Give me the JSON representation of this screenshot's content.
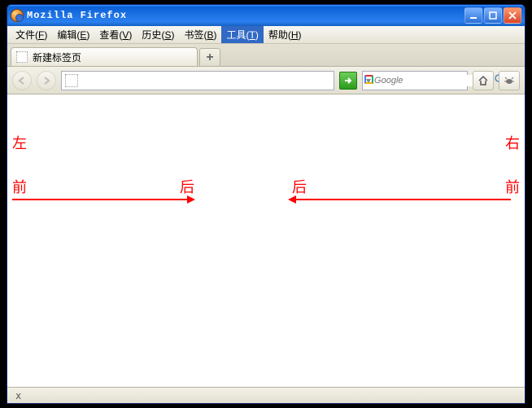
{
  "title": "Mozilla Firefox",
  "menu": {
    "items": [
      {
        "label": "文件",
        "accel": "F"
      },
      {
        "label": "编辑",
        "accel": "E"
      },
      {
        "label": "查看",
        "accel": "V"
      },
      {
        "label": "历史",
        "accel": "S"
      },
      {
        "label": "书签",
        "accel": "B"
      },
      {
        "label": "工具",
        "accel": "T"
      },
      {
        "label": "帮助",
        "accel": "H"
      }
    ],
    "active_index": 5
  },
  "tabs": {
    "items": [
      {
        "label": "新建标签页"
      }
    ],
    "newtab_symbol": "+"
  },
  "toolbar": {
    "url_value": "",
    "search_placeholder": "Google"
  },
  "content": {
    "labels": {
      "left": "左",
      "right": "右",
      "front_l": "前",
      "back_l": "后",
      "back_r": "后",
      "front_r": "前"
    }
  },
  "status": {
    "close_symbol": "x"
  },
  "colors": {
    "accent_red": "#ff0000",
    "xp_blue": "#1a6fe0"
  }
}
